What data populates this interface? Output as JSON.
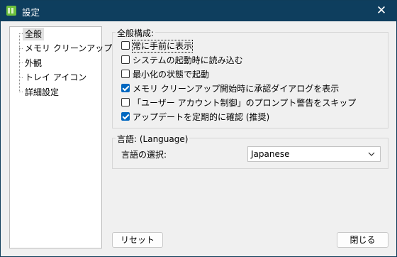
{
  "window": {
    "title": "設定",
    "close_symbol": "✕"
  },
  "tree": {
    "items": [
      "全般",
      "メモリ クリーンアップ",
      "外観",
      "トレイ アイコン",
      "詳細設定"
    ],
    "selected_index": 0
  },
  "general_group": {
    "title": "全般構成:",
    "options": [
      {
        "label": "常に手前に表示",
        "checked": false
      },
      {
        "label": "システムの起動時に読み込む",
        "checked": false
      },
      {
        "label": "最小化の状態で起動",
        "checked": false
      },
      {
        "label": "メモリ クリーンアップ開始時に承認ダイアログを表示",
        "checked": true
      },
      {
        "label": "「ユーザー アカウント制御」のプロンプト警告をスキップ",
        "checked": false
      },
      {
        "label": "アップデートを定期的に確認 (推奨)",
        "checked": true
      }
    ]
  },
  "language_group": {
    "title": "言語: (Language)",
    "label": "言語の選択:",
    "selected": "Japanese"
  },
  "buttons": {
    "reset": "リセット",
    "close": "閉じる"
  },
  "colors": {
    "titlebar": "#0e3e5e",
    "accent": "#0067c0",
    "app_icon": "#6cbf3c"
  }
}
